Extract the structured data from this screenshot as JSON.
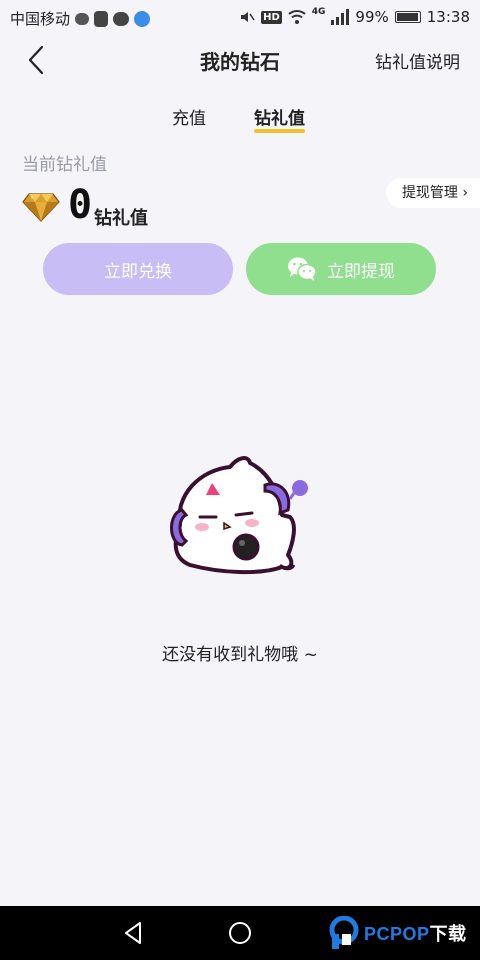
{
  "status_bar": {
    "carrier": "中国移动",
    "network": "4G",
    "hd": "HD",
    "battery": "99%",
    "time": "13:38"
  },
  "header": {
    "title": "我的钻石",
    "right_link": "钻礼值说明"
  },
  "tabs": [
    {
      "label": "充值",
      "active": false
    },
    {
      "label": "钻礼值",
      "active": true
    }
  ],
  "balance": {
    "label": "当前钻礼值",
    "value": "0",
    "unit": "钻礼值",
    "manage_link": "提现管理 ›"
  },
  "buttons": {
    "exchange": "立即兑换",
    "withdraw": "立即提现"
  },
  "empty_state": {
    "message": "还没有收到礼物哦 ~"
  },
  "watermark": {
    "brand": "PCPOP",
    "suffix": "下载"
  },
  "colors": {
    "background": "#f4f4f9",
    "tab_underline": "#f3c12c",
    "exchange_button": "#c9bdf5",
    "withdraw_button": "#8fdf8f"
  }
}
